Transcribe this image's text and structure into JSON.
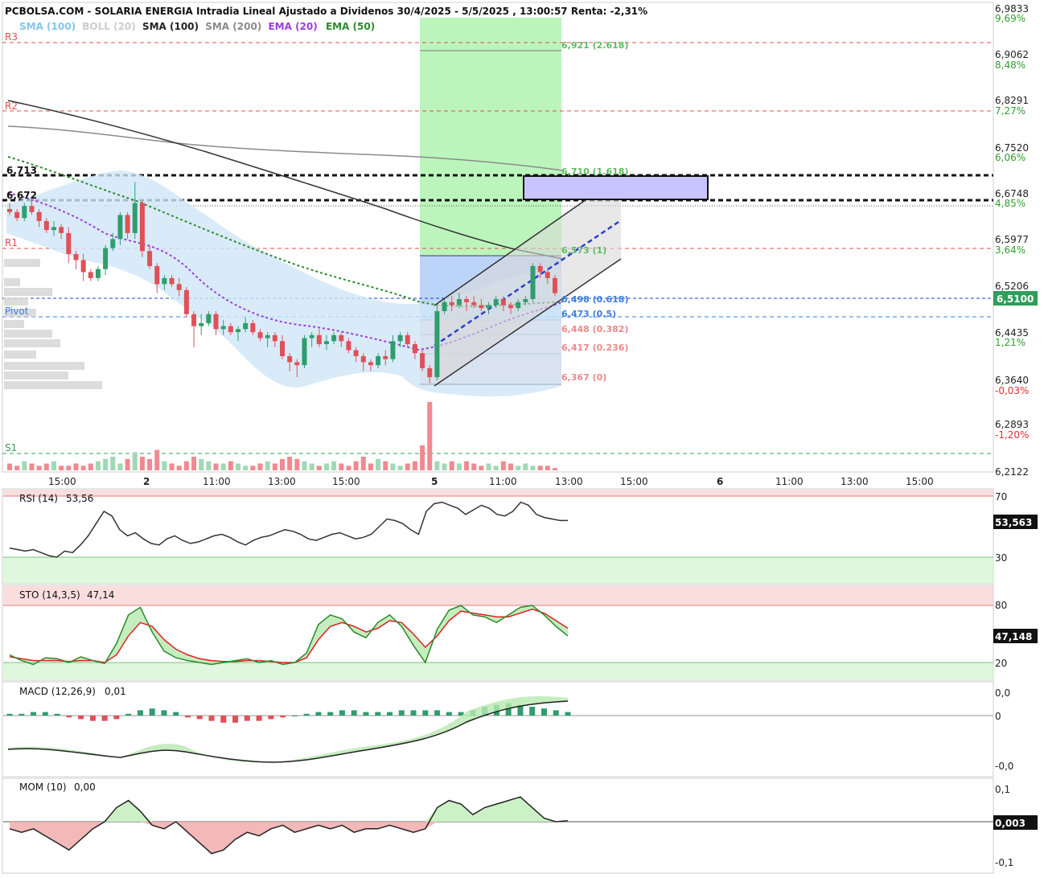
{
  "header": {
    "title": "PCBOLSA.COM - SOLARIA ENERGIA Intradia Lineal Ajustado a Dividenos 30/4/2025 - 5/5/2025 , 13:00:57 Renta: -2,31%"
  },
  "legend": [
    {
      "label": "SMA (100)",
      "color": "#86c5ee"
    },
    {
      "label": "BOLL (20)",
      "color": "#cccccc"
    },
    {
      "label": "SMA (100)",
      "color": "#222222"
    },
    {
      "label": "SMA (200)",
      "color": "#8a8a8a"
    },
    {
      "label": "EMA (20)",
      "color": "#9b3fdc"
    },
    {
      "label": "EMA (50)",
      "color": "#2e8b2e"
    }
  ],
  "levels": {
    "r3": "R3",
    "r2": "R2",
    "r1": "R1",
    "pivot": "Pivot",
    "s1": "S1",
    "mark_upper": "6,713",
    "mark_lower": "6,672"
  },
  "fib_labels": [
    {
      "text": "6,921 (2.618)",
      "color": "#5dbb5d"
    },
    {
      "text": "6,710 (1.618)",
      "color": "#5dbb5d"
    },
    {
      "text": "6,573 (1)",
      "color": "#5dbb5d"
    },
    {
      "text": "6,498 (0.618)",
      "color": "#3d7de0"
    },
    {
      "text": "6,473 (0.5)",
      "color": "#3d7de0"
    },
    {
      "text": "6,448 (0.382)",
      "color": "#e88a8a"
    },
    {
      "text": "6,417 (0.236)",
      "color": "#e88a8a"
    },
    {
      "text": "6,367 (0)",
      "color": "#e88a8a"
    }
  ],
  "price_axis": {
    "ticks": [
      "6,9833",
      "6,9062",
      "6,8291",
      "6,7520",
      "6,6748",
      "6,5977",
      "6,5206",
      "6,4435",
      "6,3640",
      "6,2893",
      "6,2122"
    ],
    "pct": [
      {
        "text": "9,69%",
        "color": "#2e9e2e"
      },
      {
        "text": "8,48%",
        "color": "#2e9e2e"
      },
      {
        "text": "7,27%",
        "color": "#2e9e2e"
      },
      {
        "text": "6,06%",
        "color": "#2e9e2e"
      },
      {
        "text": "4,85%",
        "color": "#2e9e2e"
      },
      {
        "text": "3,64%",
        "color": "#2e9e2e"
      },
      {
        "text": "1,21%",
        "color": "#2e9e2e"
      },
      {
        "text": "-0,03%",
        "color": "#e03030"
      },
      {
        "text": "-1,20%",
        "color": "#e03030"
      }
    ],
    "current_price": "6,5100"
  },
  "time_axis": [
    "15:00",
    "2",
    "11:00",
    "13:00",
    "15:00",
    "5",
    "11:00",
    "13:00",
    "15:00",
    "6",
    "11:00",
    "13:00",
    "15:00"
  ],
  "panels": {
    "rsi": {
      "label": "RSI (14)",
      "value": "53,56",
      "tag": "53,563",
      "ticks": [
        "70",
        "30"
      ]
    },
    "sto": {
      "label": "STO (14,3,5)",
      "value": "47,14",
      "tag": "47,148",
      "ticks": [
        "80",
        "20"
      ]
    },
    "macd": {
      "label": "MACD (12,26,9)",
      "value": "0,01",
      "ticks": [
        "0,0",
        "0",
        "-0,0"
      ]
    },
    "mom": {
      "label": "MOM (10)",
      "value": "0,00",
      "tag": "0,003",
      "ticks": [
        "0,1",
        "-0,1"
      ]
    }
  },
  "chart_data": {
    "type": "candlestick",
    "title": "PCBOLSA.COM - SOLARIA ENERGIA Intradia Lineal Ajustado a Dividenos 30/4/2025 - 5/5/2025 , 13:00:57 Renta: -2,31%",
    "ylim": [
      6.2122,
      6.9833
    ],
    "last_price": 6.51,
    "candles_ohlc": [
      [
        6.65,
        6.66,
        6.64,
        6.645
      ],
      [
        6.645,
        6.65,
        6.63,
        6.635
      ],
      [
        6.635,
        6.66,
        6.63,
        6.655
      ],
      [
        6.655,
        6.665,
        6.64,
        6.645
      ],
      [
        6.645,
        6.65,
        6.62,
        6.63
      ],
      [
        6.63,
        6.635,
        6.61,
        6.615
      ],
      [
        6.615,
        6.63,
        6.605,
        6.62
      ],
      [
        6.62,
        6.625,
        6.6,
        6.61
      ],
      [
        6.61,
        6.62,
        6.56,
        6.575
      ],
      [
        6.575,
        6.58,
        6.55,
        6.565
      ],
      [
        6.565,
        6.575,
        6.53,
        6.545
      ],
      [
        6.545,
        6.55,
        6.53,
        6.535
      ],
      [
        6.535,
        6.555,
        6.53,
        6.55
      ],
      [
        6.55,
        6.59,
        6.54,
        6.585
      ],
      [
        6.585,
        6.61,
        6.58,
        6.6
      ],
      [
        6.6,
        6.645,
        6.59,
        6.64
      ],
      [
        6.64,
        6.645,
        6.6,
        6.61
      ],
      [
        6.61,
        6.695,
        6.6,
        6.66
      ],
      [
        6.66,
        6.665,
        6.57,
        6.58
      ],
      [
        6.58,
        6.59,
        6.55,
        6.555
      ],
      [
        6.555,
        6.56,
        6.51,
        6.525
      ],
      [
        6.525,
        6.54,
        6.515,
        6.535
      ],
      [
        6.535,
        6.54,
        6.52,
        6.525
      ],
      [
        6.525,
        6.535,
        6.505,
        6.515
      ],
      [
        6.515,
        6.52,
        6.47,
        6.475
      ],
      [
        6.475,
        6.48,
        6.42,
        6.455
      ],
      [
        6.455,
        6.475,
        6.44,
        6.46
      ],
      [
        6.46,
        6.48,
        6.455,
        6.475
      ],
      [
        6.475,
        6.48,
        6.44,
        6.45
      ],
      [
        6.45,
        6.465,
        6.44,
        6.455
      ],
      [
        6.455,
        6.46,
        6.44,
        6.445
      ],
      [
        6.445,
        6.455,
        6.43,
        6.45
      ],
      [
        6.45,
        6.47,
        6.445,
        6.46
      ],
      [
        6.46,
        6.465,
        6.44,
        6.445
      ],
      [
        6.445,
        6.45,
        6.43,
        6.435
      ],
      [
        6.435,
        6.445,
        6.42,
        6.44
      ],
      [
        6.44,
        6.445,
        6.42,
        6.43
      ],
      [
        6.43,
        6.44,
        6.4,
        6.405
      ],
      [
        6.405,
        6.41,
        6.38,
        6.395
      ],
      [
        6.395,
        6.4,
        6.37,
        6.39
      ],
      [
        6.39,
        6.44,
        6.385,
        6.435
      ],
      [
        6.435,
        6.445,
        6.42,
        6.44
      ],
      [
        6.44,
        6.45,
        6.42,
        6.425
      ],
      [
        6.425,
        6.44,
        6.415,
        6.43
      ],
      [
        6.43,
        6.445,
        6.425,
        6.44
      ],
      [
        6.44,
        6.445,
        6.42,
        6.43
      ],
      [
        6.43,
        6.435,
        6.41,
        6.415
      ],
      [
        6.415,
        6.42,
        6.395,
        6.405
      ],
      [
        6.405,
        6.41,
        6.38,
        6.395
      ],
      [
        6.395,
        6.4,
        6.38,
        6.39
      ],
      [
        6.39,
        6.41,
        6.385,
        6.405
      ],
      [
        6.405,
        6.415,
        6.39,
        6.4
      ],
      [
        6.4,
        6.44,
        6.395,
        6.43
      ],
      [
        6.43,
        6.445,
        6.42,
        6.44
      ],
      [
        6.44,
        6.445,
        6.42,
        6.425
      ],
      [
        6.425,
        6.43,
        6.4,
        6.41
      ],
      [
        6.41,
        6.415,
        6.38,
        6.385
      ],
      [
        6.385,
        6.39,
        6.36,
        6.37
      ],
      [
        6.37,
        6.49,
        6.365,
        6.48
      ],
      [
        6.48,
        6.5,
        6.475,
        6.495
      ],
      [
        6.495,
        6.505,
        6.48,
        6.49
      ],
      [
        6.49,
        6.51,
        6.485,
        6.5
      ],
      [
        6.5,
        6.505,
        6.48,
        6.495
      ],
      [
        6.495,
        6.505,
        6.485,
        6.49
      ],
      [
        6.49,
        6.5,
        6.48,
        6.485
      ],
      [
        6.485,
        6.495,
        6.475,
        6.49
      ],
      [
        6.49,
        6.505,
        6.485,
        6.5
      ],
      [
        6.5,
        6.505,
        6.48,
        6.49
      ],
      [
        6.49,
        6.495,
        6.475,
        6.485
      ],
      [
        6.485,
        6.5,
        6.48,
        6.495
      ],
      [
        6.495,
        6.505,
        6.49,
        6.5
      ],
      [
        6.5,
        6.56,
        6.495,
        6.555
      ],
      [
        6.555,
        6.56,
        6.535,
        6.545
      ],
      [
        6.545,
        6.55,
        6.525,
        6.535
      ],
      [
        6.535,
        6.54,
        6.505,
        6.51
      ]
    ],
    "volume": [
      3,
      2,
      4,
      3,
      2,
      3,
      4,
      2,
      2,
      3,
      2,
      3,
      4,
      5,
      6,
      3,
      5,
      8,
      6,
      5,
      9,
      4,
      3,
      2,
      4,
      6,
      5,
      4,
      3,
      3,
      4,
      3,
      2,
      2,
      3,
      4,
      3,
      5,
      6,
      5,
      4,
      3,
      2,
      3,
      4,
      3,
      2,
      4,
      6,
      3,
      5,
      4,
      3,
      2,
      3,
      4,
      11,
      30,
      4,
      3,
      4,
      3,
      4,
      3,
      2,
      3,
      2,
      4,
      3,
      2,
      3,
      2,
      2,
      2,
      1
    ],
    "rsi": [
      36,
      35,
      34,
      35,
      33,
      31,
      30,
      34,
      33,
      38,
      44,
      52,
      60,
      57,
      48,
      44,
      46,
      42,
      39,
      38,
      42,
      44,
      41,
      39,
      40,
      42,
      44,
      45,
      43,
      40,
      38,
      41,
      43,
      44,
      46,
      48,
      47,
      45,
      42,
      41,
      43,
      45,
      46,
      44,
      42,
      43,
      45,
      50,
      55,
      54,
      52,
      48,
      45,
      60,
      65,
      66,
      64,
      62,
      58,
      61,
      64,
      62,
      58,
      57,
      60,
      66,
      64,
      58,
      56,
      55,
      54,
      54
    ],
    "sto_k": [
      28,
      22,
      18,
      25,
      24,
      20,
      26,
      22,
      19,
      40,
      70,
      78,
      52,
      32,
      25,
      22,
      20,
      18,
      20,
      22,
      24,
      20,
      22,
      18,
      20,
      30,
      60,
      70,
      66,
      52,
      46,
      62,
      70,
      58,
      38,
      20,
      55,
      75,
      80,
      70,
      68,
      62,
      70,
      78,
      80,
      70,
      58,
      48
    ],
    "sto_d": [
      26,
      24,
      22,
      22,
      22,
      21,
      22,
      22,
      20,
      28,
      48,
      62,
      58,
      44,
      34,
      28,
      24,
      22,
      21,
      21,
      22,
      22,
      21,
      20,
      20,
      25,
      44,
      58,
      62,
      58,
      52,
      56,
      64,
      62,
      50,
      36,
      48,
      64,
      74,
      72,
      70,
      68,
      68,
      72,
      76,
      72,
      64,
      56
    ],
    "macd_hist": [
      1,
      1,
      2,
      2,
      1,
      -1,
      -2,
      -3,
      -3,
      -2,
      1,
      3,
      4,
      3,
      2,
      -1,
      -2,
      -3,
      -4,
      -4,
      -3,
      -3,
      -2,
      -1,
      0,
      1,
      2,
      2,
      3,
      3,
      2,
      2,
      2,
      3,
      3,
      3,
      3,
      2,
      2,
      3,
      5,
      6,
      7,
      6,
      5,
      4,
      3,
      2
    ],
    "mom": [
      -0.02,
      -0.03,
      -0.02,
      -0.04,
      -0.06,
      -0.08,
      -0.05,
      -0.02,
      0.0,
      0.04,
      0.06,
      0.03,
      -0.01,
      -0.02,
      0.0,
      -0.03,
      -0.06,
      -0.09,
      -0.08,
      -0.05,
      -0.03,
      -0.04,
      -0.02,
      -0.01,
      -0.03,
      -0.02,
      -0.01,
      -0.02,
      -0.01,
      -0.03,
      -0.02,
      -0.02,
      -0.01,
      -0.02,
      -0.03,
      -0.02,
      0.04,
      0.06,
      0.05,
      0.02,
      0.04,
      0.05,
      0.06,
      0.07,
      0.04,
      0.01,
      0.0,
      0.003
    ]
  }
}
